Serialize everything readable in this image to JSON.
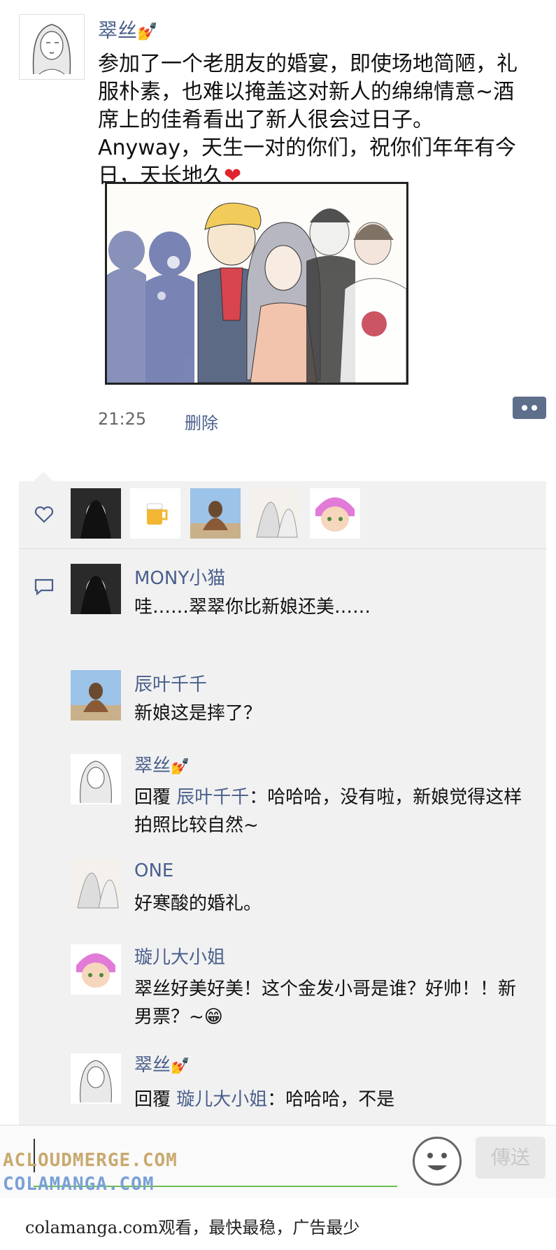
{
  "post": {
    "author": "翠丝",
    "text": "参加了一个老朋友的婚宴，即使场地简陋，礼服朴素，也难以掩盖这对新人的绵绵情意~酒席上的佳肴看出了新人很会过日子。Anyway，天生一对的你们，祝你们年年有今日，天长地久",
    "time": "21:25",
    "delete_label": "删除"
  },
  "comments": [
    {
      "name": "MONY小猫",
      "text": "哇……翠翠你比新娘还美……"
    },
    {
      "name": "辰叶千千",
      "text": "新娘这是摔了？"
    },
    {
      "name": "翠丝",
      "reply_label": "回覆",
      "reply_to": "辰叶千千",
      "text": "：哈哈哈，没有啦，新娘觉得这样拍照比较自然~"
    },
    {
      "name": "ONE",
      "text": "好寒酸的婚礼。"
    },
    {
      "name": "璇儿大小姐",
      "text": "翠丝好美好美！这个金发小哥是谁？好帅！！新男票？~"
    },
    {
      "name": "翠丝",
      "reply_label": "回覆",
      "reply_to": "璇儿大小姐",
      "text": "：哈哈哈，不是"
    }
  ],
  "input_bar": {
    "send_label": "傳送"
  },
  "watermarks": {
    "line1": "ACLOUDMERGE.COM",
    "line2": "COLAMANGA.COM"
  },
  "footer": "colamanga.com观看，最快最稳，广告最少",
  "icons": {
    "like": "heart-icon",
    "comment": "comment-icon",
    "more": "more-dots-icon",
    "emoji": "emoji-icon"
  },
  "colors": {
    "name_link": "#4a5f8c",
    "panel_bg": "#f1f1f1",
    "input_underline": "#6cbf4e"
  }
}
